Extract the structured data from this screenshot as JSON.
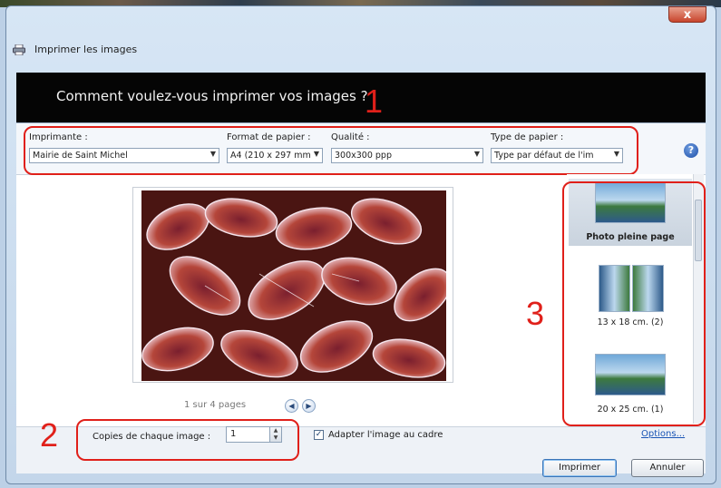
{
  "window": {
    "title": "Imprimer les images",
    "close_label": "x",
    "banner": "Comment voulez-vous imprimer vos images ?"
  },
  "annotations": {
    "one": "1",
    "two": "2",
    "three": "3"
  },
  "options": {
    "printer_label": "Imprimante :",
    "printer_value": "Mairie de Saint Michel",
    "paper_size_label": "Format de papier :",
    "paper_size_value": "A4 (210 x 297 mm",
    "quality_label": "Qualité :",
    "quality_value": "300x300 ppp",
    "paper_type_label": "Type de papier :",
    "paper_type_value": "Type par défaut de l'im"
  },
  "preview": {
    "pager_text": "1 sur 4 pages"
  },
  "layouts": [
    {
      "label": "Photo pleine page",
      "selected": true
    },
    {
      "label": "13 x 18 cm. (2)",
      "selected": false
    },
    {
      "label": "20 x 25 cm. (1)",
      "selected": false
    }
  ],
  "bottom": {
    "copies_label": "Copies de chaque image :",
    "copies_value": "1",
    "fit_label": "Adapter l'image au cadre",
    "fit_checked": true,
    "options_link": "Options..."
  },
  "buttons": {
    "print": "Imprimer",
    "cancel": "Annuler"
  },
  "colors": {
    "annotation_red": "#e0201a",
    "banner_bg": "#050505",
    "link_blue": "#1a55b5"
  }
}
